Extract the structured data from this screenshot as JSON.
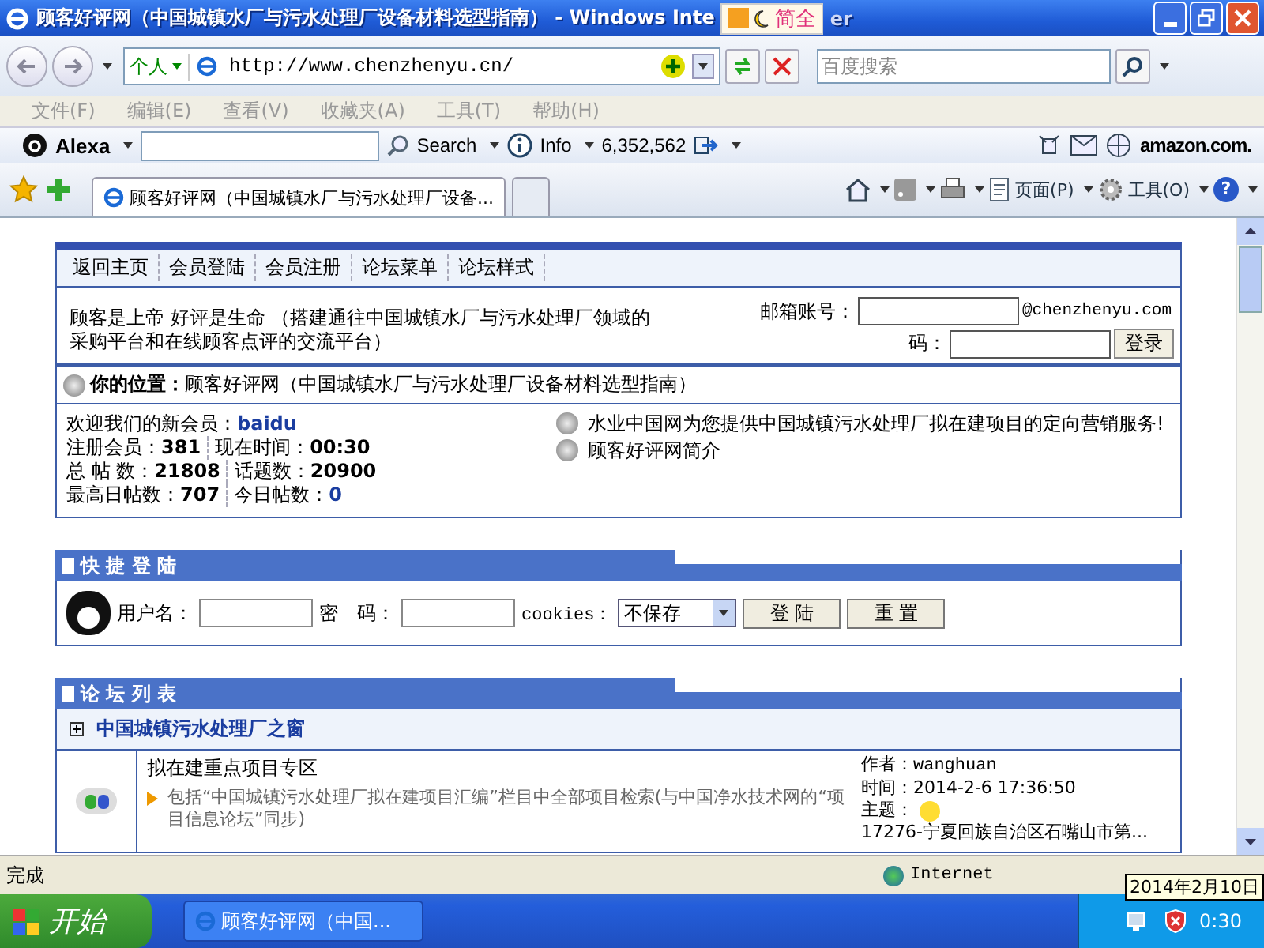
{
  "window": {
    "title": "顾客好评网（中国城镇水厂与污水处理厂设备材料选型指南） - Windows Inte",
    "title_tail": "er",
    "ime_text": "简全"
  },
  "address_bar": {
    "profile": "个人",
    "url": "http://www.chenzhenyu.cn/",
    "search_placeholder": "百度搜索"
  },
  "menu": [
    {
      "label": "文件(F)",
      "disabled": true
    },
    {
      "label": "编辑(E)",
      "disabled": true
    },
    {
      "label": "查看(V)",
      "disabled": true
    },
    {
      "label": "收藏夹(A)",
      "disabled": true
    },
    {
      "label": "工具(T)",
      "disabled": true
    },
    {
      "label": "帮助(H)",
      "disabled": true
    }
  ],
  "alexa": {
    "brand": "Alexa",
    "search": "Search",
    "info": "Info",
    "rank": "6,352,562",
    "amazon": "amazon.com."
  },
  "tabs": [
    {
      "label": "顾客好评网（中国城镇水厂与污水处理厂设备...",
      "selected": true
    },
    {
      "selected": false
    }
  ],
  "command_bar": {
    "page": "页面(P)",
    "tools": "工具(O)",
    "help": "?"
  },
  "page": {
    "nav": [
      "返回主页",
      "会员登陆",
      "会员注册",
      "论坛菜单",
      "论坛样式"
    ],
    "slogan": "顾客是上帝 好评是生命 （搭建通往中国城镇水厂与污水处理厂领域的采购平台和在线顾客点评的交流平台）",
    "email_label": "邮箱账号：",
    "email_domain": "@chenzhenyu.com",
    "password_label": "码：",
    "login_button": "登录",
    "location_label": "你的位置：",
    "location": "顾客好评网（中国城镇水厂与污水处理厂设备材料选型指南）",
    "stats": [
      [
        {
          "label": "欢迎我们的新会员：",
          "value": "baidu",
          "kind": "link"
        }
      ],
      [
        {
          "label": "注册会员：",
          "value": "381",
          "kind": "bold"
        },
        {
          "label": "现在时间：",
          "value": "00:30",
          "kind": "bold"
        }
      ],
      [
        {
          "label": "总 帖 数：",
          "value": "21808",
          "kind": "bold"
        },
        {
          "label": "话题数：",
          "value": "20900",
          "kind": "bold"
        }
      ],
      [
        {
          "label": "最高日帖数：",
          "value": "707",
          "kind": "bold"
        },
        {
          "label": "今日帖数：",
          "value": "0",
          "kind": "link"
        }
      ]
    ],
    "notices": [
      "水业中国网为您提供中国城镇污水处理厂拟在建项目的定向营销服务!",
      "顾客好评网简介"
    ],
    "quick_login": {
      "title": "快 捷 登 陆",
      "username_label": "用户名：",
      "password_label": "密　码：",
      "cookies_label": "cookies：",
      "cookies_value": "不保存",
      "login": "登 陆",
      "reset": "重 置"
    },
    "forum_list": {
      "title": "论 坛 列 表",
      "category": "中国城镇污水处理厂之窗",
      "category_expanded": false,
      "forums": [
        {
          "name": "拟在建重点项目专区",
          "description": "包括“中国城镇污水处理厂拟在建项目汇编”栏目中全部项目检索(与中国净水技术网的“项目信息论坛”同步)",
          "author_label": "作者：",
          "author": "wanghuan",
          "time_label": "时间：",
          "time": "2014-2-6 17:36:50",
          "topic_label": "主题：",
          "topic": "17276-宁夏回族自治区石嘴山市第..."
        }
      ]
    }
  },
  "status_bar": {
    "text": "完成",
    "zone": "Internet"
  },
  "taskbar": {
    "start": "开始",
    "tasks": [
      "顾客好评网（中国..."
    ],
    "clock": "0:30",
    "tooltip": "2014年2月10日"
  }
}
